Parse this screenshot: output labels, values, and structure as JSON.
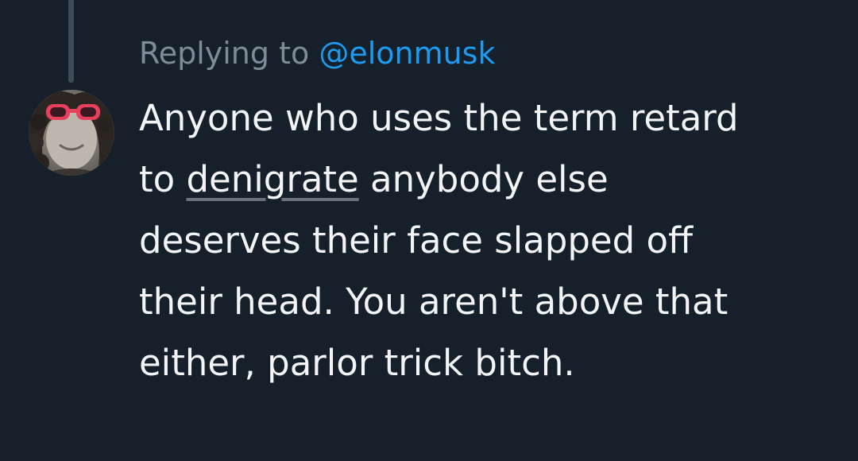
{
  "reply": {
    "prefix": "Replying to ",
    "handle": "@elonmusk"
  },
  "tweet": {
    "lines": [
      {
        "text": "Anyone who uses the term retard"
      },
      {
        "before": "to ",
        "highlight": "denigrate",
        "after": " anybody else"
      },
      {
        "text": "deserves their face slapped off"
      },
      {
        "text": "their head. You aren't above that"
      },
      {
        "text": "either, parlor trick bitch."
      }
    ]
  },
  "colors": {
    "background": "#16202a",
    "text": "#f2f4f6",
    "muted": "#7f8b98",
    "mention": "#1d9bf0",
    "thread_line": "#3d4a57",
    "sunglasses": "#e8405c"
  },
  "icons": {
    "avatar": "profile-photo-woman-pink-sunglasses"
  }
}
